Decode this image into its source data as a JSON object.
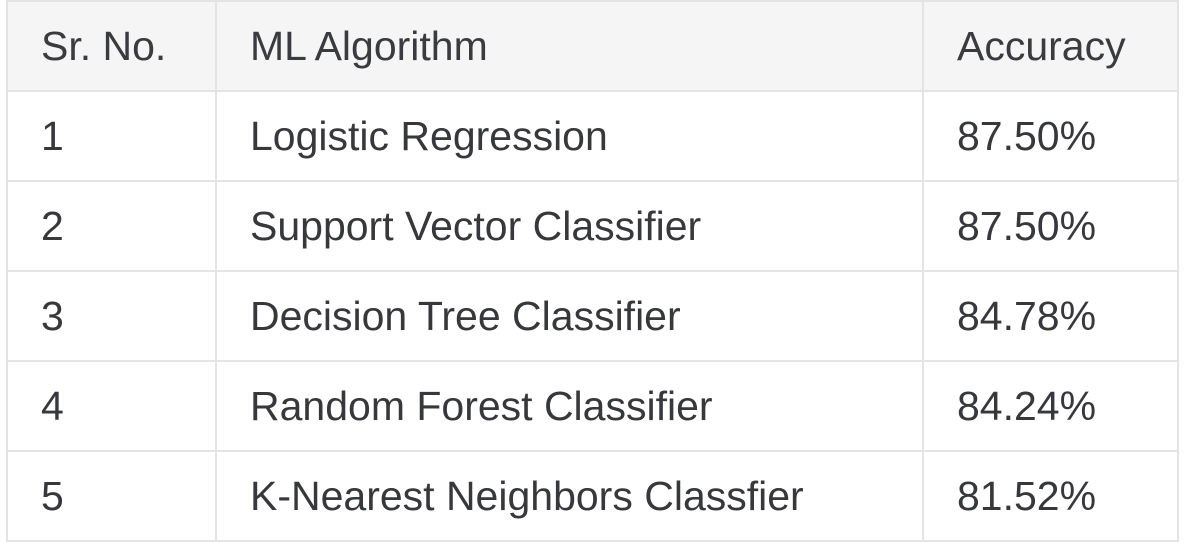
{
  "table": {
    "headers": [
      "Sr. No.",
      "ML Algorithm",
      "Accuracy"
    ],
    "rows": [
      [
        "1",
        "Logistic Regression",
        "87.50%"
      ],
      [
        "2",
        "Support Vector Classifier",
        "87.50%"
      ],
      [
        "3",
        "Decision Tree Classifier",
        "84.78%"
      ],
      [
        "4",
        "Random Forest Classifier",
        "84.24%"
      ],
      [
        "5",
        "K-Nearest Neighbors Classfier",
        "81.52%"
      ]
    ]
  },
  "colors": {
    "border": "#e4e4e4",
    "header_bg": "#f5f5f5",
    "text": "#37383c"
  }
}
